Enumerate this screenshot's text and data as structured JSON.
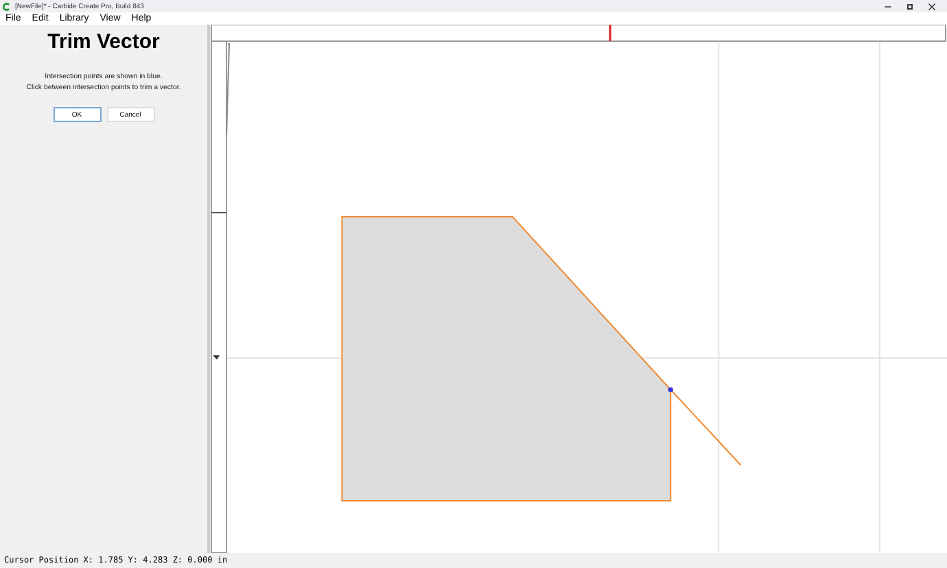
{
  "window": {
    "title": "[NewFile]* - Carbide Create Pro, Build 843"
  },
  "menu": [
    "File",
    "Edit",
    "Library",
    "View",
    "Help"
  ],
  "panel": {
    "title": "Trim Vector",
    "lines": [
      "Intersection points are shown in blue.",
      "Click between intersection points to trim a vector."
    ],
    "buttons": [
      {
        "label": "OK",
        "selected": true
      },
      {
        "label": "Cancel",
        "selected": false
      }
    ]
  },
  "status_bar": "Cursor Position X: 1.785 Y: 4.283 Z: 0.000 in"
}
